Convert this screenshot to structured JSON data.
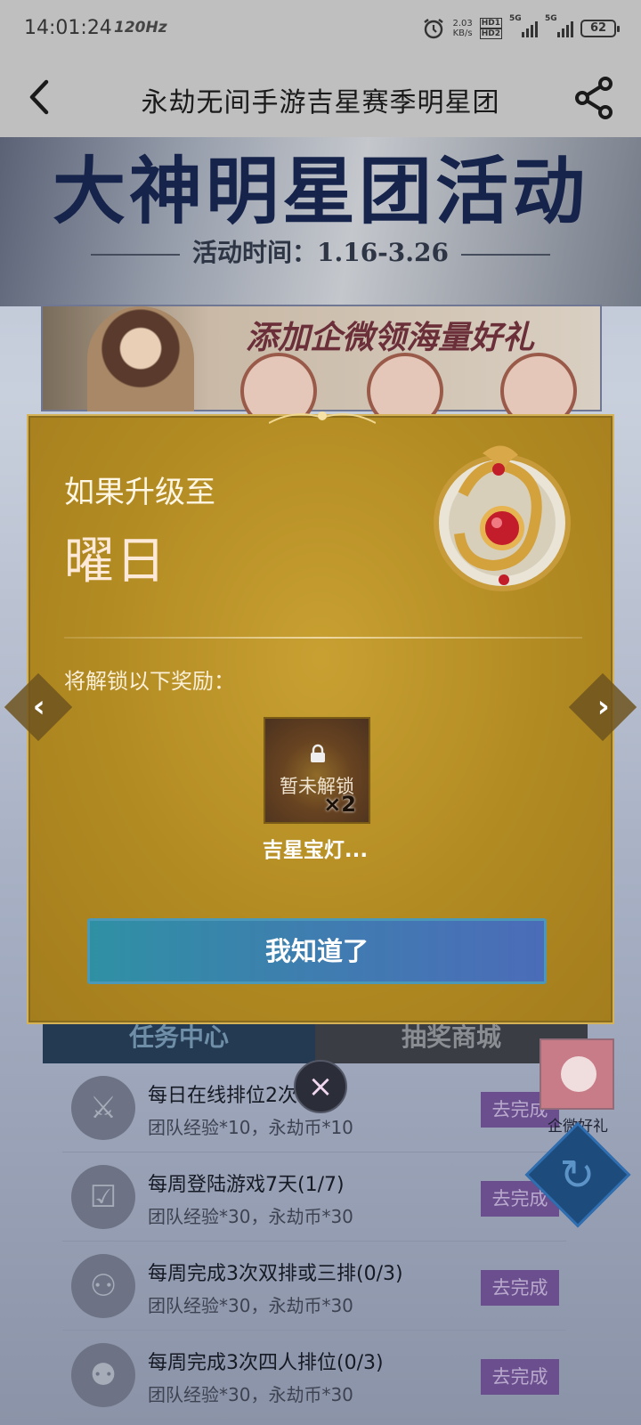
{
  "status": {
    "time": "14:01:24",
    "refresh_rate": "120Hz",
    "speed_value": "2.03",
    "speed_unit": "KB/s",
    "hd1": "HD1",
    "hd2": "HD2",
    "net1": "5G",
    "net2": "5G",
    "battery": "62"
  },
  "header": {
    "title": "永劫无间手游吉星赛季明星团"
  },
  "hero": {
    "title": "大神明星团活动",
    "time_range": "活动时间：1.16-3.26"
  },
  "banner": {
    "text": "添加企微领海量好礼"
  },
  "tabs": [
    {
      "label": "任务中心"
    },
    {
      "label": "抽奖商城"
    }
  ],
  "tasks": [
    {
      "name": "每日在线排位2次",
      "reward": "团队经验*10，永劫币*10",
      "button": "去完成"
    },
    {
      "name": "每周登陆游戏7天(1/7)",
      "reward": "团队经验*30，永劫币*30",
      "button": "去完成"
    },
    {
      "name": "每周完成3次双排或三排(0/3)",
      "reward": "团队经验*30，永劫币*30",
      "button": "去完成"
    },
    {
      "name": "每周完成3次四人排位(0/3)",
      "reward": "团队经验*30，永劫币*30",
      "button": "去完成"
    }
  ],
  "side_promo": {
    "label": "企微好礼"
  },
  "modal": {
    "if_upgrade_label": "如果升级至",
    "rank_name": "曜日",
    "unlock_desc": "将解锁以下奖励：",
    "reward": {
      "lock_text": "暂未解锁",
      "quantity": "×2",
      "name": "吉星宝灯..."
    },
    "confirm_label": "我知道了"
  },
  "colors": {
    "modal_gold": "#b18a22",
    "confirm_button": "#3f7db0",
    "task_button": "#6a4e8e"
  }
}
